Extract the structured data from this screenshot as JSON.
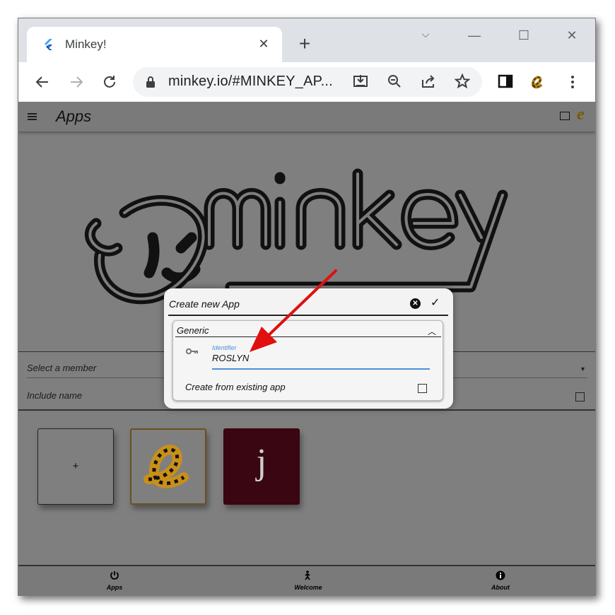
{
  "browser": {
    "tab_title": "Minkey!",
    "tab_close": "✕",
    "new_tab": "+",
    "url": "minkey.io/#MINKEY_AP...",
    "window_controls": {
      "minimize": "—",
      "maximize": "☐",
      "close": "✕",
      "tabs_menu": "⌵"
    }
  },
  "appbar": {
    "title": "Apps",
    "e_logo": "e"
  },
  "logo": {
    "text": "minkey"
  },
  "form": {
    "select_member": "Select a member",
    "include_name": "Include name"
  },
  "tiles": [
    {
      "kind": "add",
      "label": "+"
    },
    {
      "kind": "e",
      "label": "e"
    },
    {
      "kind": "j",
      "label": "j"
    }
  ],
  "bottom_nav": [
    {
      "label": "Apps",
      "icon": "power-icon"
    },
    {
      "label": "Welcome",
      "icon": "person-walking-icon"
    },
    {
      "label": "About",
      "icon": "info-icon"
    }
  ],
  "dialog": {
    "title": "Create new App",
    "section": "Generic",
    "identifier_label": "Identifier",
    "identifier_value": "ROSLYN",
    "create_from_existing": "Create from existing app"
  },
  "colors": {
    "accent": "#4a90d9",
    "overlay": "#7f7f7f",
    "tile_j": "#3a0611",
    "arrow": "#e01010"
  }
}
